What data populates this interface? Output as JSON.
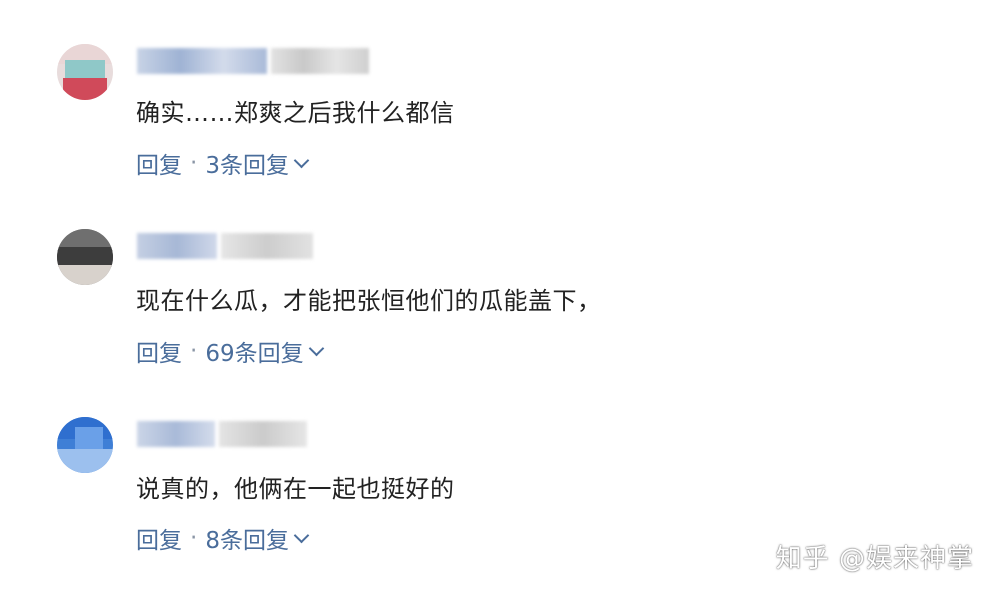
{
  "comments": [
    {
      "content": "确实……郑爽之后我什么都信",
      "reply_label": "回复",
      "separator": "·",
      "replies_label": "3条回复"
    },
    {
      "content": "现在什么瓜，才能把张恒他们的瓜能盖下，",
      "reply_label": "回复",
      "separator": "·",
      "replies_label": "69条回复"
    },
    {
      "content": "说真的，他俩在一起也挺好的",
      "reply_label": "回复",
      "separator": "·",
      "replies_label": "8条回复"
    }
  ],
  "watermark": "知乎 @娱来神掌",
  "icons": {
    "expand": "chevron-down-icon"
  },
  "colors": {
    "link": "#4a6d9b",
    "text": "#222222"
  }
}
